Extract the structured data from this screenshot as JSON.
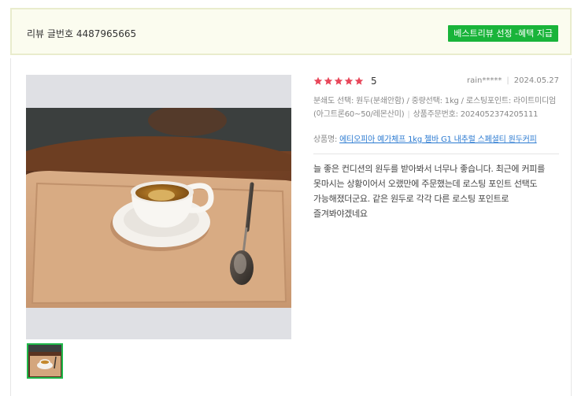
{
  "header": {
    "review_number": "리뷰 글번호 4487965665",
    "best_badge": "베스트리뷰 선정 -혜택 지급"
  },
  "review": {
    "rating": {
      "stars": 5,
      "label": "5"
    },
    "reviewer": "rain*****",
    "date": "2024.05.27",
    "options": "분쇄도 선택: 원두(분쇄안함) / 중량선택: 1kg / 로스팅포인트: 라이트미디엄(아그트론60~50/레몬산미)",
    "order_number": "상품주문번호: 2024052374205111",
    "product_label": "상품명:",
    "product_name": "에티오피아 예가체프 1kg 첼바 G1 내추럴 스페셜티 원두커피",
    "text": "늘 좋은 컨디션의 원두를 받아봐서 너무나 좋습니다. 최근에 커피를 못마시는 상황이어서 오랬만에 주문했는데 로스팅 포인트 선택도 가능해졌더군요. 같은 원두로 각각 다른 로스팅 포인트로 즐겨봐야겠네요"
  },
  "colors": {
    "star": "#e8475a",
    "badge": "#19b43a",
    "link": "#2b7ad1",
    "thumb_border": "#20b84a",
    "header_bg": "#fbfcef"
  },
  "icons": [
    "star-icon"
  ]
}
